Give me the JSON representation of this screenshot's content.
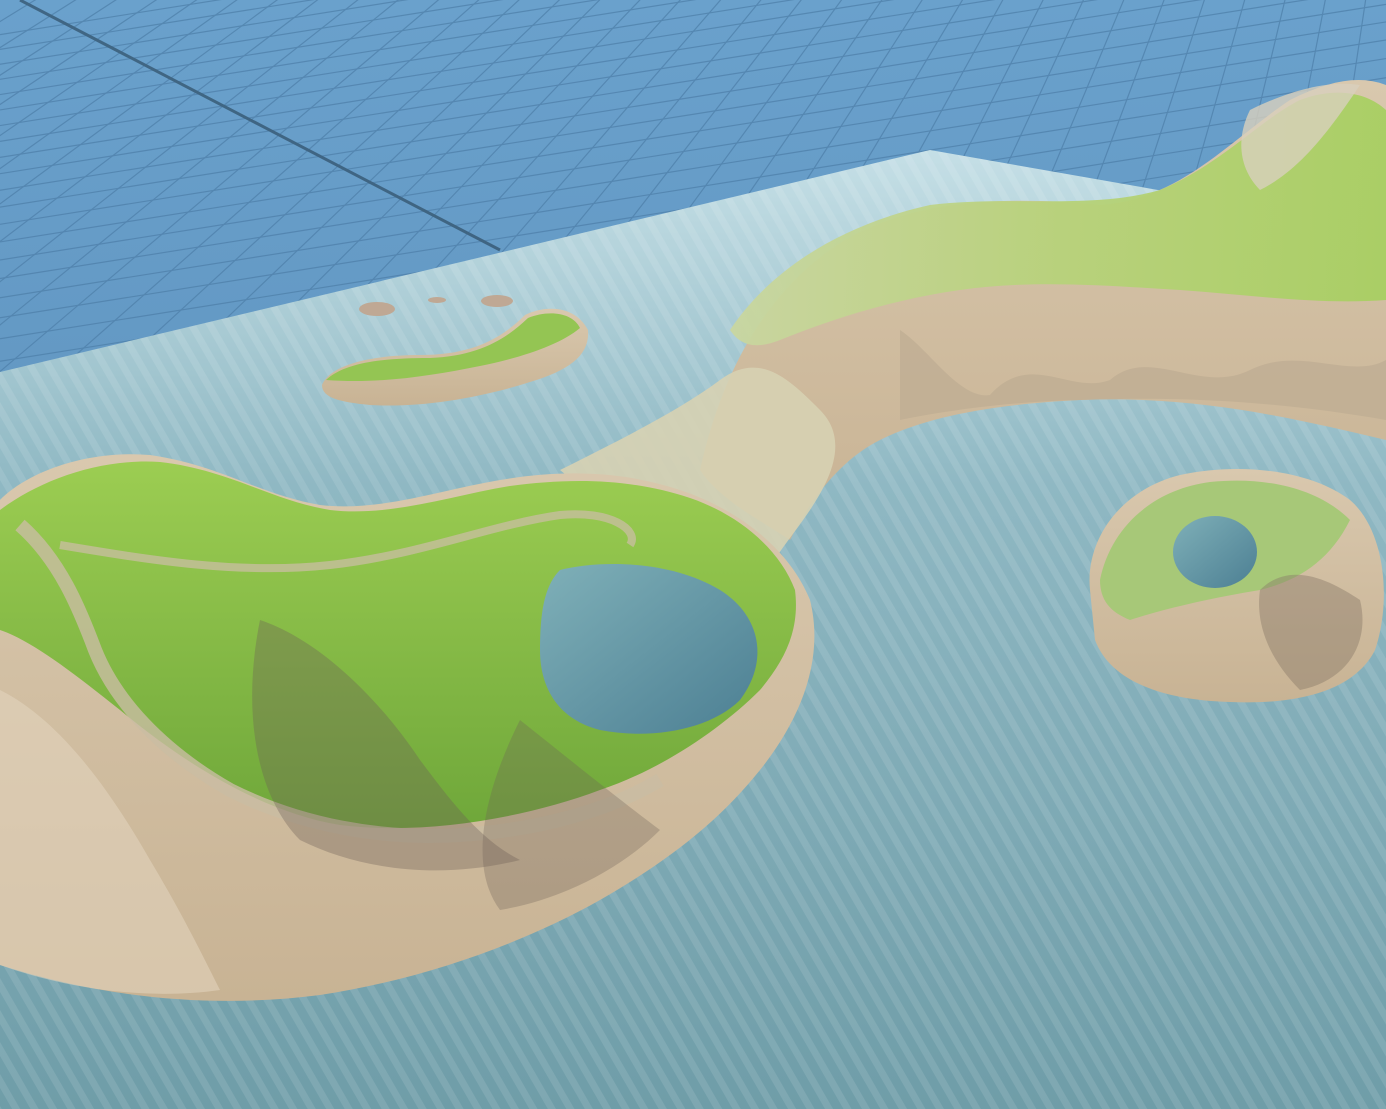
{
  "scene": {
    "kind": "3d-editor-viewport",
    "colors": {
      "grid_floor": "#5e95c2",
      "grid_line": "#4f80a8",
      "water": "#79a8b3",
      "water_far": "#b7d6dd",
      "grass": "#8fc446",
      "rock": "#cfbea5",
      "rock_shadow": "#6c5f55",
      "lake": "#5d8fa0"
    },
    "objects": [
      {
        "name": "grid-floor",
        "label": ""
      },
      {
        "name": "water-plane",
        "label": ""
      },
      {
        "name": "main-island-left",
        "label": ""
      },
      {
        "name": "island-ridge-right",
        "label": ""
      },
      {
        "name": "crater-island-right",
        "label": ""
      },
      {
        "name": "crescent-islet",
        "label": ""
      },
      {
        "name": "rock-cluster",
        "label": ""
      }
    ]
  }
}
